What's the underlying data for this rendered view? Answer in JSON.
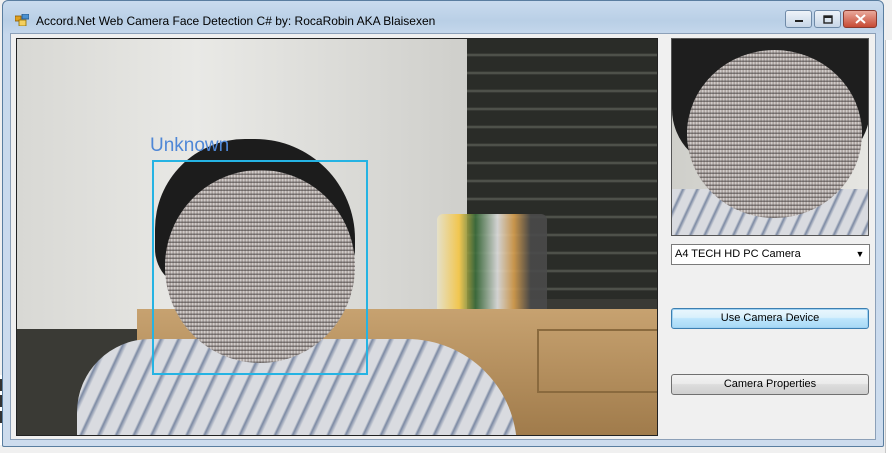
{
  "window": {
    "title": "Accord.Net Web Camera Face Detection C# by: RocaRobin AKA Blaisexen",
    "controls": {
      "minimize_icon": "minimize-icon",
      "maximize_icon": "maximize-icon",
      "close_icon": "close-icon"
    }
  },
  "camera_view": {
    "detection_label": "Unknown",
    "box_color": "#25b3e3",
    "label_color": "#4f87d6"
  },
  "controls": {
    "camera_select_value": "A4 TECH HD PC Camera",
    "use_camera_button": "Use Camera Device",
    "camera_properties_button": "Camera Properties"
  }
}
